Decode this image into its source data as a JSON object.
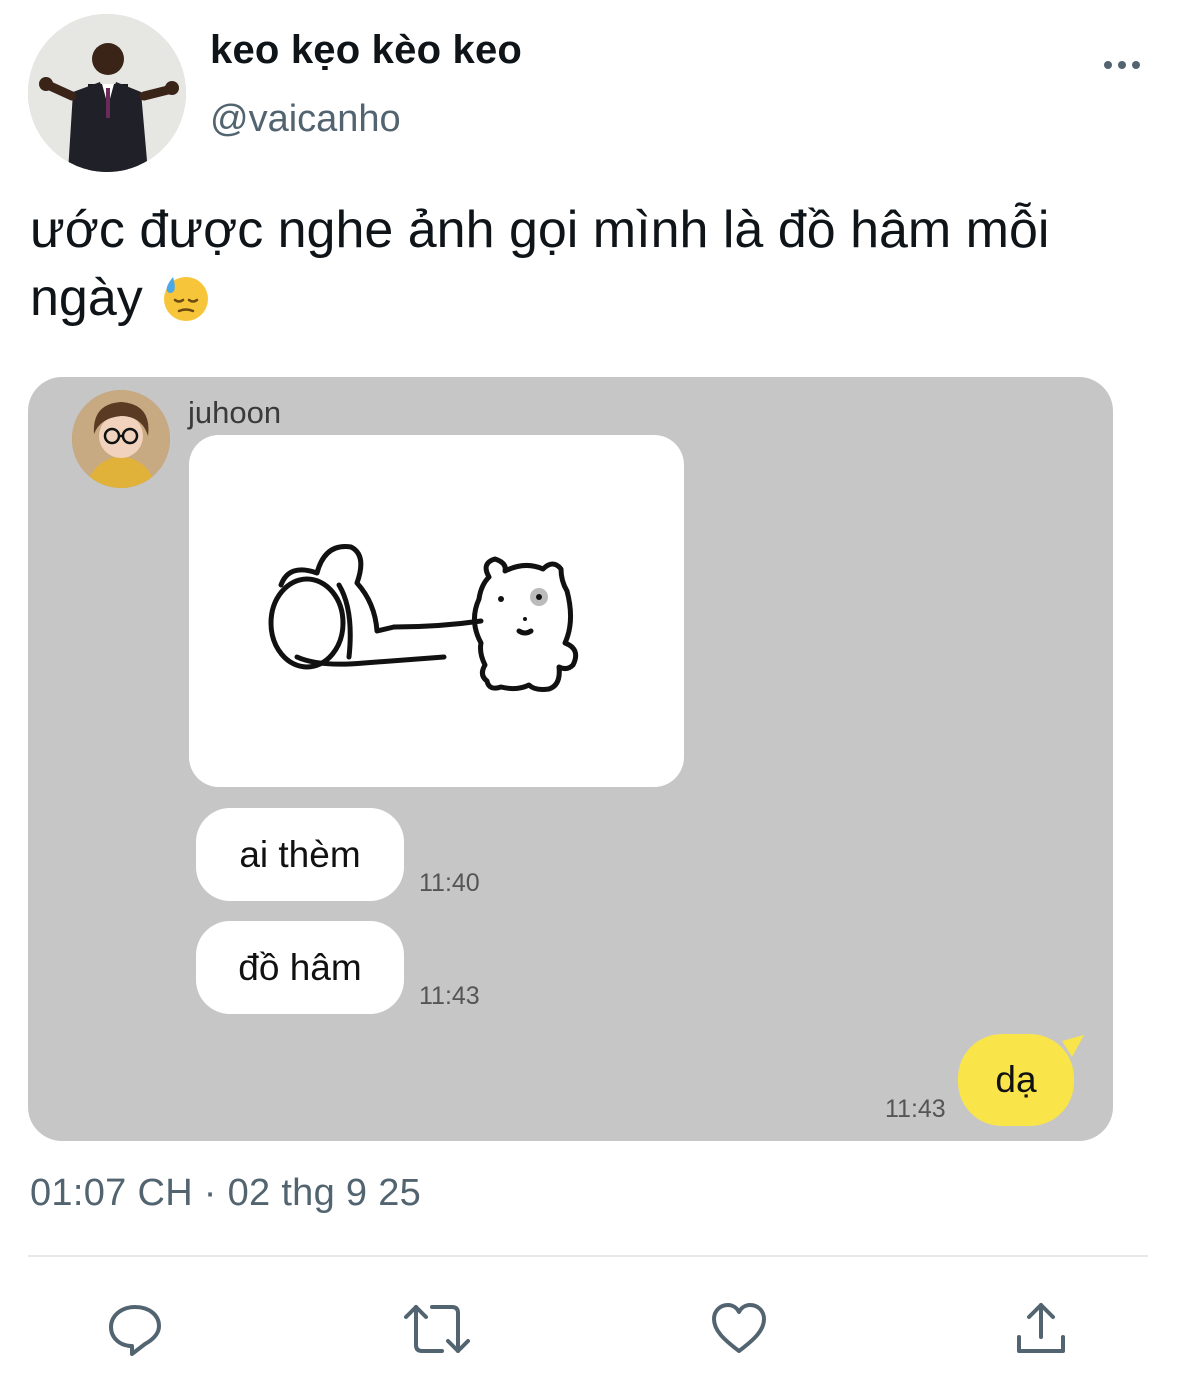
{
  "author": {
    "display_name": "keo kẹo kèo keo",
    "handle": "@vaicanho"
  },
  "tweet": {
    "text": "ước được nghe ảnh gọi mình là đồ hâm mỗi ngày",
    "emoji": "downcast-face-with-sweat-icon",
    "timestamp": "01:07 CH · 02 thg 9 25"
  },
  "chat": {
    "contact_name": "juhoon",
    "messages": [
      {
        "text": "ai thèm",
        "time": "11:40"
      },
      {
        "text": "đồ hâm",
        "time": "11:43"
      }
    ],
    "reply": {
      "text": "dạ",
      "time": "11:43"
    }
  },
  "colors": {
    "chat_background": "#c6c6c6",
    "my_bubble": "#f9e44a",
    "secondary_text": "#536471"
  },
  "actions": [
    "reply-icon",
    "retweet-icon",
    "like-icon",
    "share-icon"
  ]
}
